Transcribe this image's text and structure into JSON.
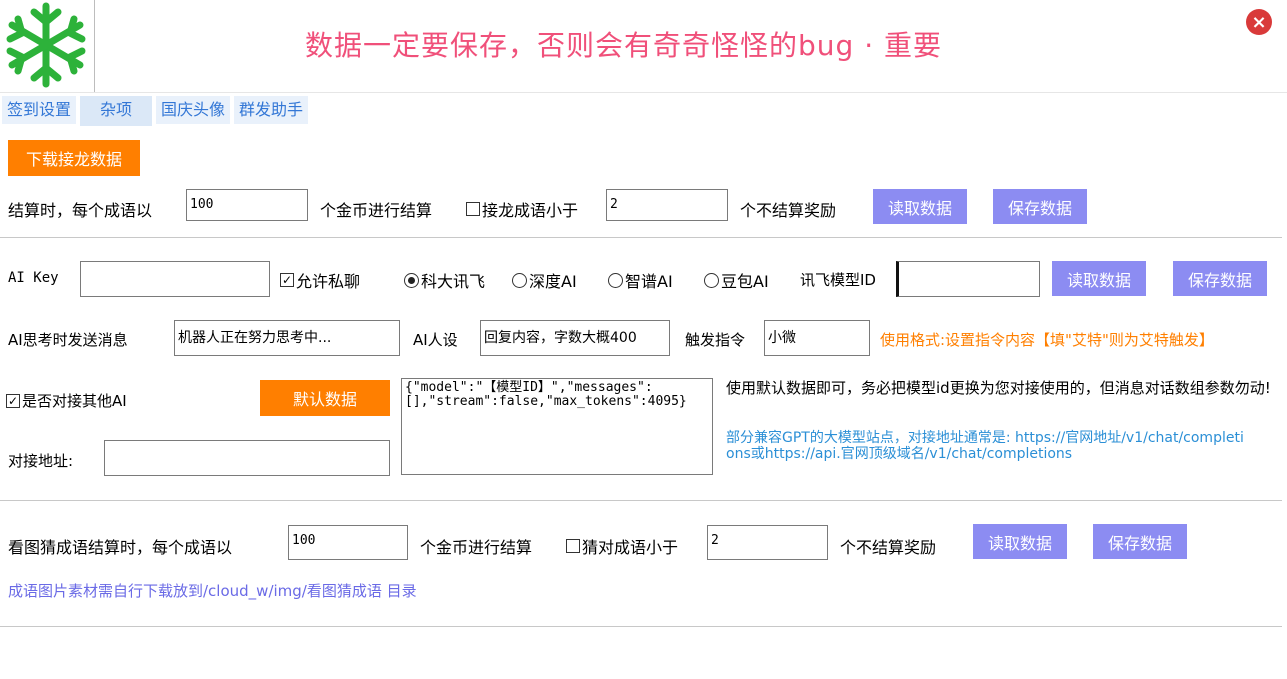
{
  "header": {
    "title": "数据一定要保存，否则会有奇奇怪怪的bug · 重要",
    "close": "×",
    "logo": "snowflake-logo"
  },
  "tabs": [
    {
      "label": "签到设置"
    },
    {
      "label": "杂项"
    },
    {
      "label": "国庆头像"
    },
    {
      "label": "群发助手"
    }
  ],
  "download_button": "下载接龙数据",
  "settle": {
    "label1": "结算时，每个成语以",
    "coins_value": "100",
    "label2": "个金币进行结算",
    "check_label": "接龙成语小于",
    "min_value": "2",
    "label3": "个不结算奖励",
    "read": "读取数据",
    "save": "保存数据"
  },
  "ai": {
    "key_label": "AI Key",
    "key_value": "",
    "allow_private": "允许私聊",
    "radios": [
      "科大讯飞",
      "深度AI",
      "智谱AI",
      "豆包AI"
    ],
    "model_label": "讯飞模型ID",
    "model_value": "",
    "read": "读取数据",
    "save": "保存数据",
    "thinking_label": "AI思考时发送消息",
    "thinking_value": "机器人正在努力思考中...",
    "persona_label": "AI人设",
    "persona_value": "回复内容，字数大概400",
    "trigger_label": "触发指令",
    "trigger_value": "小微",
    "usage": "使用格式:设置指令内容【填\"艾特\"则为艾特触发】",
    "other_ai_label": "是否对接其他AI",
    "default_button": "默认数据",
    "json_value": "{\"model\":\"【模型ID】\",\"messages\":[],\"stream\":false,\"max_tokens\":4095}",
    "address_label": "对接地址:",
    "address_value": "",
    "note1": "使用默认数据即可，务必把模型id更换为您对接使用的，但消息对话数组参数勿动!",
    "note2": "部分兼容GPT的大模型站点，对接地址通常是: https://官网地址/v1/chat/completions或https://api.官网顶级域名/v1/chat/completions"
  },
  "guess": {
    "label1": "看图猜成语结算时，每个成语以",
    "coins_value": "100",
    "label2": "个金币进行结算",
    "check_label": "猜对成语小于",
    "min_value": "2",
    "label3": "个不结算奖励",
    "read": "读取数据",
    "save": "保存数据",
    "note": "成语图片素材需自行下载放到/cloud_w/img/看图猜成语 目录"
  },
  "colors": {
    "title": "#f0507a",
    "orange": "#ff7f00",
    "purple": "#8c8cf2",
    "link": "#6a6ae6",
    "note_blue": "#2b8fd6"
  }
}
